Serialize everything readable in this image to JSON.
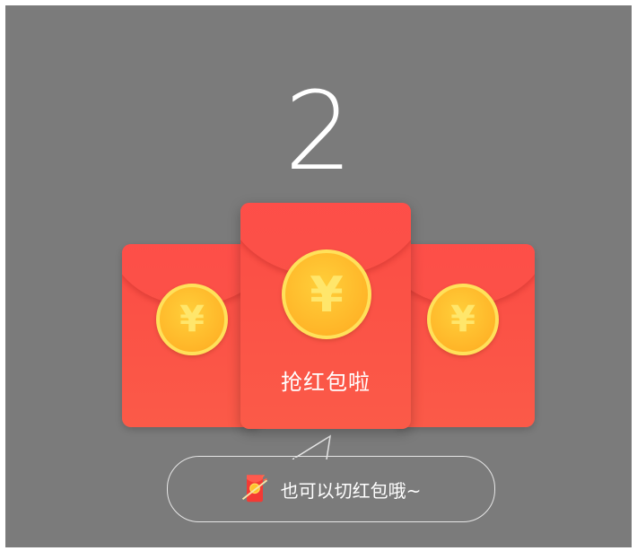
{
  "countdown": "2",
  "envelopes": {
    "currency_symbol": "¥",
    "center_label": "抢红包啦"
  },
  "hint": {
    "text": "也可以切红包哦~",
    "icon": "red-envelope-slash-icon"
  },
  "colors": {
    "overlay": "#7b7b7b",
    "envelope_red": "#fb4c45",
    "coin_gold": "#ffb528",
    "text": "#ffffff"
  }
}
